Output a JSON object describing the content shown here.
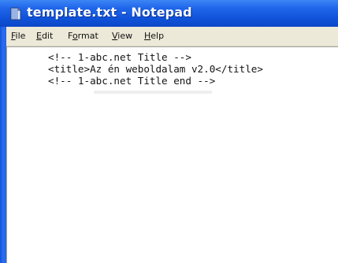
{
  "window": {
    "title": "template.txt - Notepad",
    "icon": "notepad-document-icon"
  },
  "menubar": {
    "items": [
      {
        "accel": "F",
        "rest": "ile"
      },
      {
        "accel": "E",
        "rest": "dit"
      },
      {
        "pre": "F",
        "accel": "o",
        "rest": "rmat"
      },
      {
        "accel": "V",
        "rest": "iew"
      },
      {
        "accel": "H",
        "rest": "elp"
      }
    ]
  },
  "editor": {
    "lines": [
      "<!-- 1-abc.net Title -->",
      "<title>Az én weboldalam v2.0</title>",
      "<!-- 1-abc.net Title end -->"
    ]
  },
  "colors": {
    "titlebar": "#0f52d9",
    "menubar": "#ece9d8",
    "editor_background": "#ffffff",
    "frame": "#2463e6"
  }
}
